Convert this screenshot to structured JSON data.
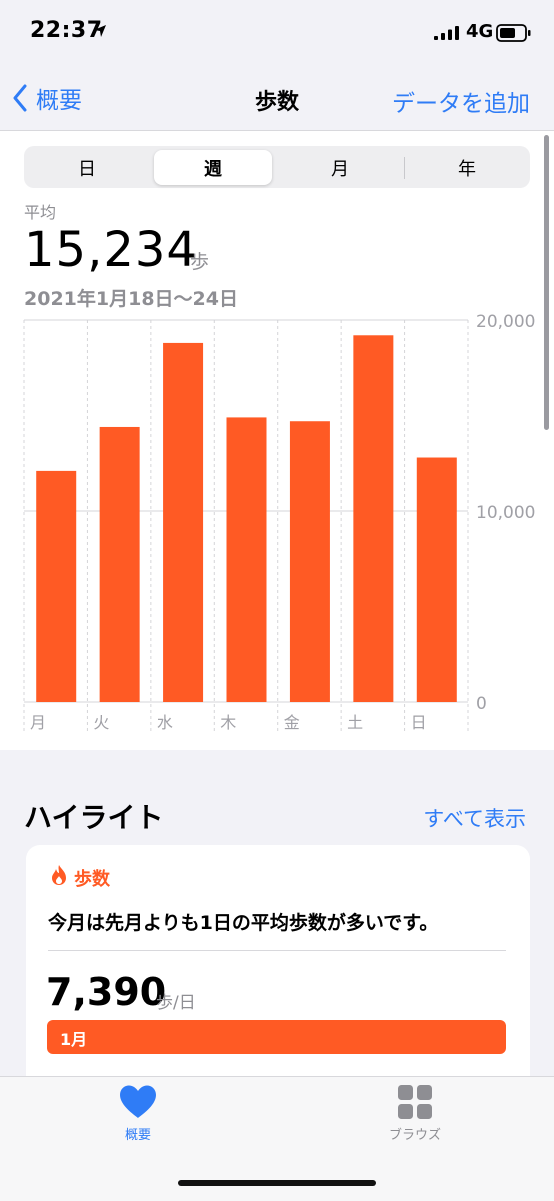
{
  "status": {
    "time": "22:37",
    "network": "4G"
  },
  "nav": {
    "back_label": "概要",
    "title": "歩数",
    "add_label": "データを追加"
  },
  "segments": [
    "日",
    "週",
    "月",
    "年"
  ],
  "selected_segment": "週",
  "summary": {
    "label": "平均",
    "value": "15,234",
    "unit": "歩",
    "date_range": "2021年1月18日〜24日"
  },
  "chart_data": {
    "type": "bar",
    "categories": [
      "月",
      "火",
      "水",
      "木",
      "金",
      "土",
      "日"
    ],
    "values": [
      12100,
      14400,
      18800,
      14900,
      14700,
      19200,
      12800
    ],
    "y_ticks": [
      "20,000",
      "10,000",
      "0"
    ],
    "ylim": [
      0,
      20000
    ],
    "grid": true,
    "bar_color": "#ff5a24"
  },
  "highlights": {
    "title": "ハイライト",
    "show_all": "すべて表示",
    "card": {
      "category": "歩数",
      "text": "今月は先月よりも1日の平均歩数が多いです。",
      "value": "7,390",
      "unit": "歩/日",
      "bar_label": "1月"
    }
  },
  "tabs": [
    {
      "label": "概要",
      "icon": "heart-icon",
      "active": true
    },
    {
      "label": "ブラウズ",
      "icon": "grid-icon",
      "active": false
    }
  ],
  "colors": {
    "accent": "#2f7cf6",
    "orange": "#ff5a24"
  }
}
